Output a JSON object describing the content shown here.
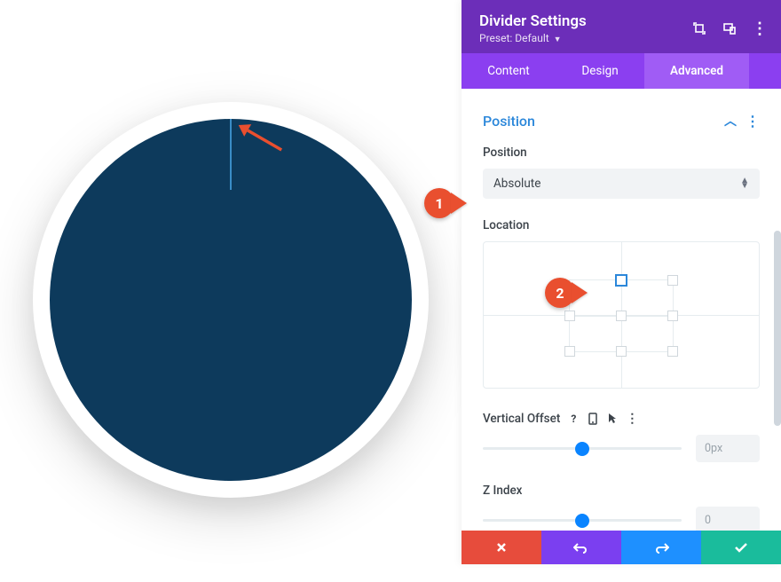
{
  "header": {
    "title": "Divider Settings",
    "preset_label": "Preset:",
    "preset_value": "Default"
  },
  "tabs": {
    "content": "Content",
    "design": "Design",
    "advanced": "Advanced"
  },
  "section": {
    "title": "Position"
  },
  "fields": {
    "position_label": "Position",
    "position_value": "Absolute",
    "location_label": "Location",
    "vertical_offset_label": "Vertical Offset",
    "vertical_offset_value": "0px",
    "z_index_label": "Z Index",
    "z_index_value": "0"
  },
  "callouts": {
    "one": "1",
    "two": "2"
  }
}
